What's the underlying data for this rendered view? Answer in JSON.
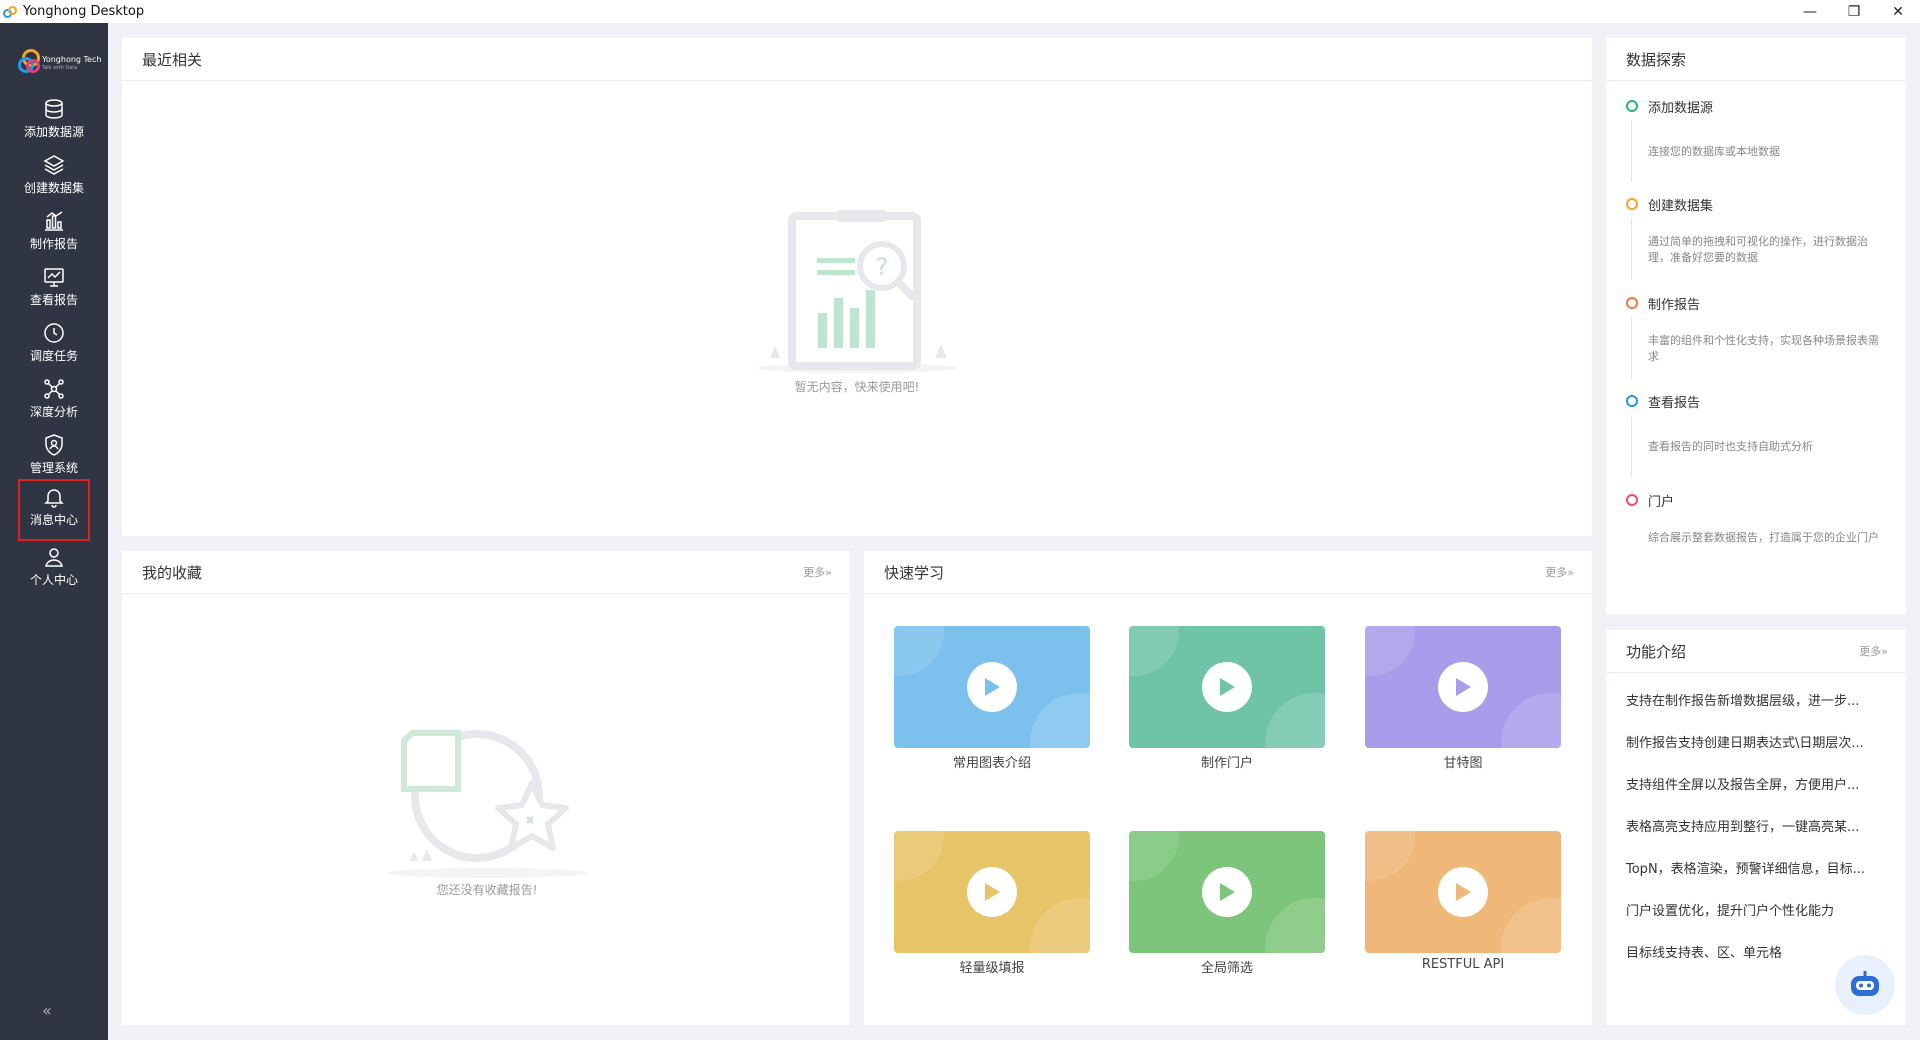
{
  "window": {
    "title": "Yonghong Desktop",
    "controls": [
      "—",
      "❐",
      "✕"
    ]
  },
  "logo": {
    "line1": "Yonghong Tech",
    "line2": "Talk with Data"
  },
  "sidebar": {
    "items": [
      {
        "label": "添加数据源",
        "icon": "database-icon"
      },
      {
        "label": "创建数据集",
        "icon": "layers-icon"
      },
      {
        "label": "制作报告",
        "icon": "bar-chart-icon"
      },
      {
        "label": "查看报告",
        "icon": "monitor-chart-icon"
      },
      {
        "label": "调度任务",
        "icon": "clock-icon"
      },
      {
        "label": "深度分析",
        "icon": "network-icon"
      },
      {
        "label": "管理系统",
        "icon": "shield-user-icon"
      },
      {
        "label": "消息中心",
        "icon": "bell-icon"
      },
      {
        "label": "个人中心",
        "icon": "user-icon"
      }
    ],
    "collapse": "«"
  },
  "recent": {
    "title": "最近相关",
    "empty_text": "暂无内容，快来使用吧!"
  },
  "favorites": {
    "title": "我的收藏",
    "more": "更多»",
    "empty_text": "您还没有收藏报告!"
  },
  "learning": {
    "title": "快速学习",
    "more": "更多»",
    "videos": [
      {
        "label": "常用图表介绍",
        "color": "#7cc1ee"
      },
      {
        "label": "制作门户",
        "color": "#6fc4a8"
      },
      {
        "label": "甘特图",
        "color": "#a99cea"
      },
      {
        "label": "轻量级填报",
        "color": "#e8c468"
      },
      {
        "label": "全局筛选",
        "color": "#7dc57a"
      },
      {
        "label": "RESTFUL API",
        "color": "#efb778"
      }
    ]
  },
  "explore": {
    "title": "数据探索",
    "steps": [
      {
        "title": "添加数据源",
        "desc": "连接您的数据库或本地数据",
        "color": "#2bb673"
      },
      {
        "title": "创建数据集",
        "desc": "通过简单的拖拽和可视化的操作，进行数据治理，准备好您要的数据",
        "color": "#f5a623"
      },
      {
        "title": "制作报告",
        "desc": "丰富的组件和个性化支持，实现各种场景报表需求",
        "color": "#f07b3f"
      },
      {
        "title": "查看报告",
        "desc": "查看报告的同时也支持自助式分析",
        "color": "#1e9be9"
      },
      {
        "title": "门户",
        "desc": "综合展示整套数据报告，打造属于您的企业门户",
        "color": "#f0506e"
      }
    ]
  },
  "features": {
    "title": "功能介绍",
    "more": "更多»",
    "items": [
      "支持在制作报告新增数据层级，进一步...",
      "制作报告支持创建日期表达式\\日期层次...",
      "支持组件全屏以及报告全屏，方便用户...",
      "表格高亮支持应用到整行，一键高亮某...",
      "TopN，表格渲染，预警详细信息，目标...",
      "门户设置优化，提升门户个性化能力",
      "目标线支持表、区、单元格"
    ]
  }
}
